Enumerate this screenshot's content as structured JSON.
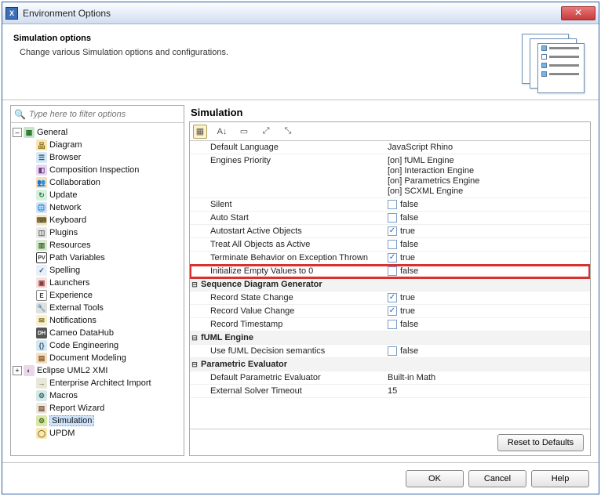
{
  "window": {
    "title": "Environment Options"
  },
  "header": {
    "title": "Simulation options",
    "desc": "Change various Simulation options and configurations."
  },
  "filter": {
    "placeholder": "Type here to filter options"
  },
  "tree": {
    "root1": "General",
    "items": [
      "Diagram",
      "Browser",
      "Composition Inspection",
      "Collaboration",
      "Update",
      "Network",
      "Keyboard",
      "Plugins",
      "Resources",
      "Path Variables",
      "Spelling",
      "Launchers",
      "Experience",
      "External Tools",
      "Notifications",
      "Cameo DataHub",
      "Code Engineering",
      "Document Modeling"
    ],
    "root2": "Eclipse UML2 XMI",
    "ent": "Enterprise Architect Import",
    "macros": "Macros",
    "report": "Report Wizard",
    "sim": "Simulation",
    "updm": "UPDM"
  },
  "right": {
    "title": "Simulation",
    "props_top": [
      {
        "name": "Default Language",
        "value": "JavaScript Rhino"
      }
    ],
    "engines_label": "Engines Priority",
    "engines": [
      "[on] fUML Engine",
      "[on] Interaction Engine",
      "[on] Parametrics Engine",
      "[on] SCXML Engine"
    ],
    "bool_props": [
      {
        "name": "Silent",
        "checked": false,
        "value": "false"
      },
      {
        "name": "Auto Start",
        "checked": false,
        "value": "false"
      },
      {
        "name": "Autostart Active Objects",
        "checked": true,
        "value": "true"
      },
      {
        "name": "Treat All Objects as Active",
        "checked": false,
        "value": "false"
      },
      {
        "name": "Terminate Behavior on Exception Thrown",
        "checked": true,
        "value": "true"
      },
      {
        "name": "Initialize Empty Values to 0",
        "checked": false,
        "value": "false",
        "highlighted": true
      }
    ],
    "groups": [
      {
        "title": "Sequence Diagram Generator",
        "rows": [
          {
            "name": "Record State Change",
            "checked": true,
            "value": "true"
          },
          {
            "name": "Record Value Change",
            "checked": true,
            "value": "true"
          },
          {
            "name": "Record Timestamp",
            "checked": false,
            "value": "false"
          }
        ]
      },
      {
        "title": "fUML Engine",
        "rows": [
          {
            "name": "Use fUML Decision semantics",
            "checked": false,
            "value": "false"
          }
        ]
      },
      {
        "title": "Parametric Evaluator",
        "rows": [
          {
            "name": "Default Parametric Evaluator",
            "plain": "Built-in Math"
          },
          {
            "name": "External Solver Timeout",
            "plain": "15"
          }
        ]
      }
    ]
  },
  "buttons": {
    "reset": "Reset to Defaults",
    "ok": "OK",
    "cancel": "Cancel",
    "help": "Help"
  }
}
